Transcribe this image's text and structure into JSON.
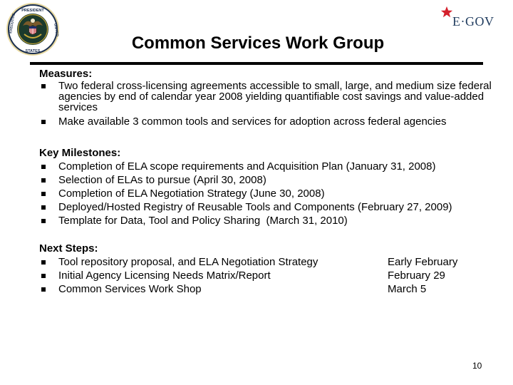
{
  "logos": {
    "seal_icon": "executive-office-seal",
    "egov": {
      "star_icon": "red-star",
      "text": "E·GOV",
      "star_color": "#d4202c",
      "text_color": "#1f3b5e"
    }
  },
  "title": "Common Services Work Group",
  "measures": {
    "heading": "Measures:",
    "items": [
      "Two federal cross-licensing agreements accessible to small, large, and medium size federal agencies by end of calendar year 2008 yielding quantifiable cost savings and value-added services",
      "Make available 3 common tools and services for adoption across federal agencies"
    ]
  },
  "milestones": {
    "heading": "Key Milestones:",
    "items": [
      "Completion of ELA scope requirements and Acquisition Plan (January 31, 2008)",
      "Selection of ELAs to pursue (April 30, 2008)",
      "Completion of ELA Negotiation Strategy (June 30, 2008)",
      "Deployed/Hosted Registry of Reusable Tools and Components (February 27, 2009)",
      "Template for Data, Tool and Policy Sharing  (March 31, 2010)"
    ]
  },
  "next_steps": {
    "heading": "Next Steps:",
    "items": [
      {
        "task": "Tool repository proposal, and ELA Negotiation Strategy",
        "date": "Early February"
      },
      {
        "task": "Initial Agency Licensing Needs Matrix/Report",
        "date": "February 29"
      },
      {
        "task": "Common Services Work Shop",
        "date": "March 5"
      }
    ]
  },
  "page_number": "10"
}
